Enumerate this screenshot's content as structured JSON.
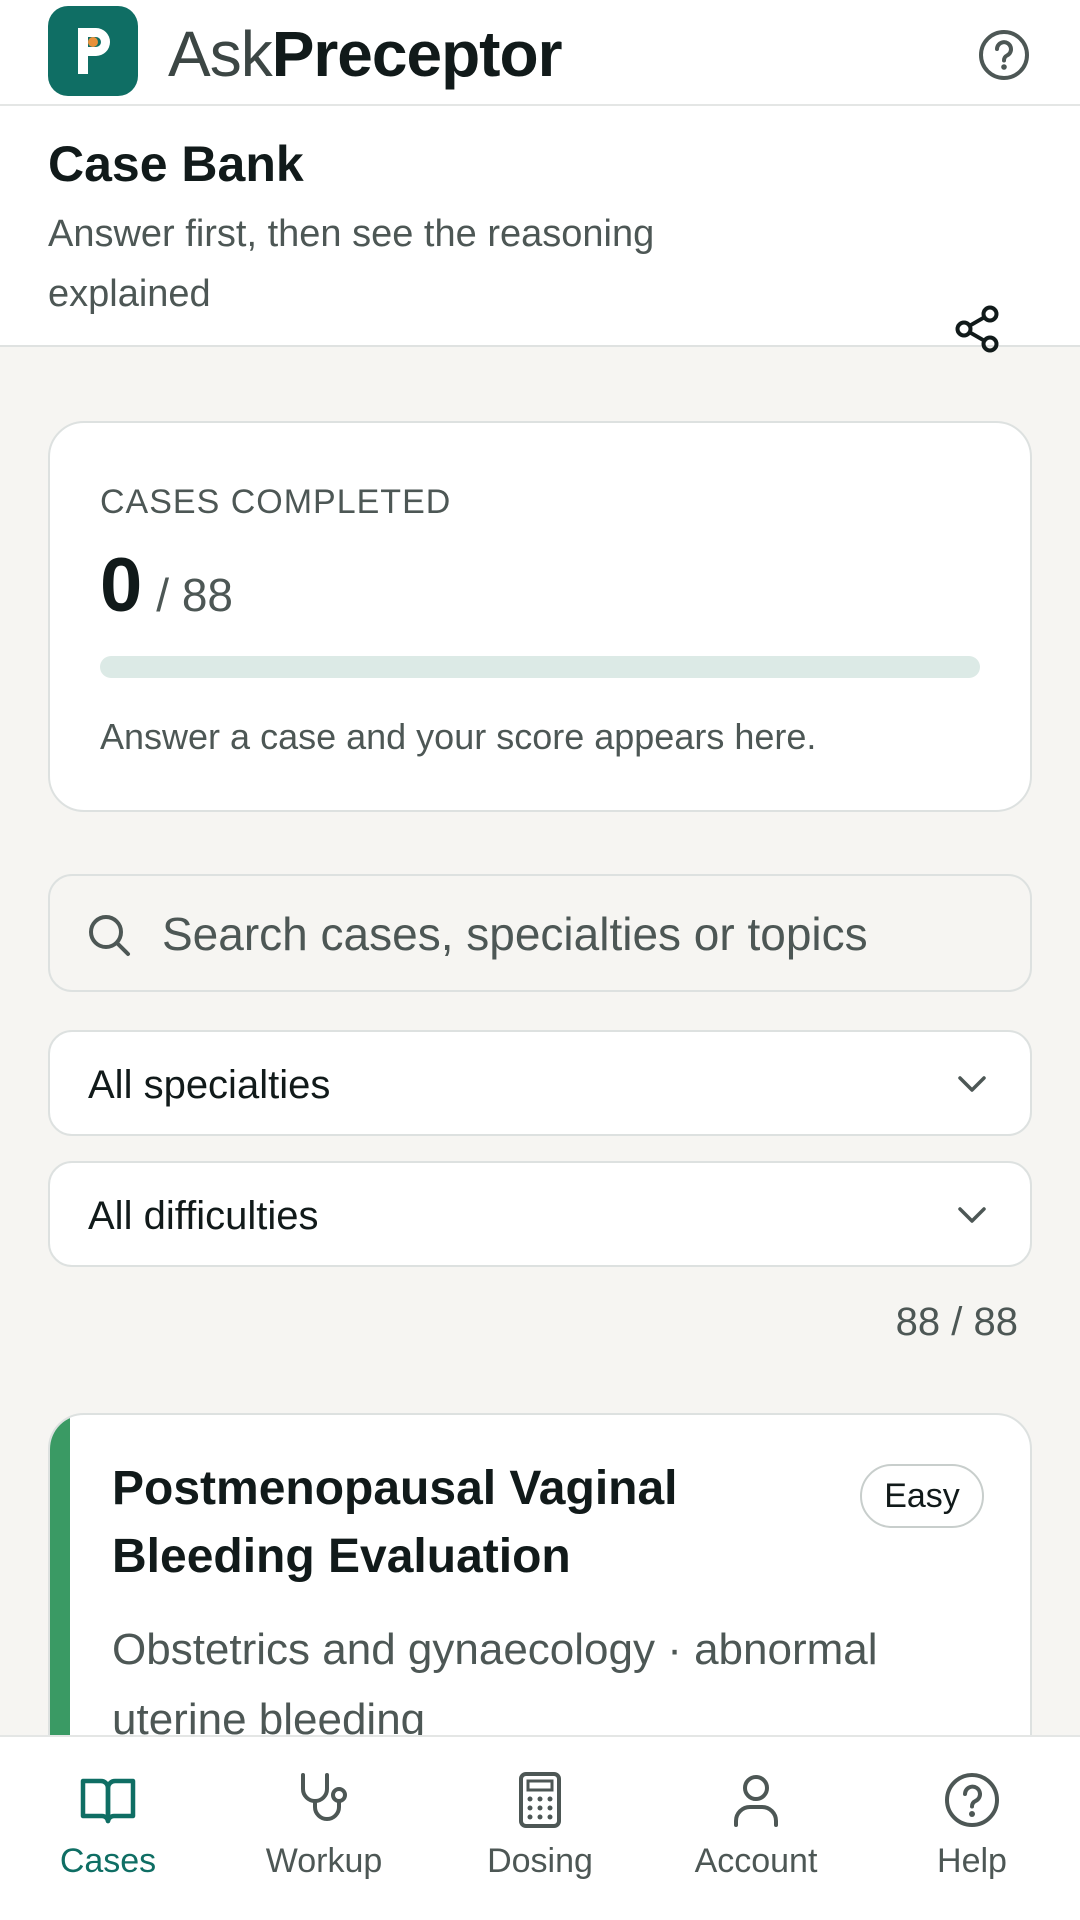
{
  "app": {
    "logo_letter": "P",
    "brand_prefix": "Ask",
    "brand_name": "Preceptor",
    "brand_color": "#0f6e64"
  },
  "header": {
    "title": "Case Bank",
    "subtitle": "Answer first, then see the reasoning explained"
  },
  "progress": {
    "label": "CASES COMPLETED",
    "completed": "0",
    "total_text": "/ 88",
    "completed_fraction": 0,
    "hint": "Answer a case and your score appears here."
  },
  "search": {
    "placeholder": "Search cases, specialties or topics",
    "value": ""
  },
  "filters": {
    "specialty": "All specialties",
    "difficulty": "All difficulties"
  },
  "result_count": "88 / 88",
  "cases": [
    {
      "title": "Postmenopausal Vaginal Bleeding Evaluation",
      "difficulty": "Easy",
      "meta": "Obstetrics and gynaecology · abnormal uterine bleeding",
      "accent_color": "#3a9a64"
    }
  ],
  "nav": {
    "items": [
      {
        "label": "Cases",
        "icon": "book-icon",
        "active": true
      },
      {
        "label": "Workup",
        "icon": "stethoscope-icon",
        "active": false
      },
      {
        "label": "Dosing",
        "icon": "calculator-icon",
        "active": false
      },
      {
        "label": "Account",
        "icon": "user-icon",
        "active": false
      },
      {
        "label": "Help",
        "icon": "help-icon",
        "active": false
      }
    ]
  },
  "colors": {
    "accent": "#0f6e64",
    "muted_text": "#4d5755",
    "background": "#f6f5f2",
    "easy": "#3a9a64"
  }
}
